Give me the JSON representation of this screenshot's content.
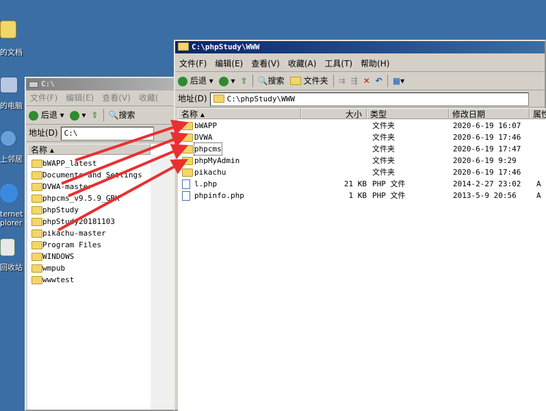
{
  "desktop": {
    "icons": [
      {
        "label": "的文档",
        "icon": "my-documents-icon"
      },
      {
        "label": "的电脑",
        "icon": "my-computer-icon"
      },
      {
        "label": "上邻居",
        "icon": "network-places-icon"
      },
      {
        "label": "ternet",
        "icon": "internet-explorer-icon",
        "label2": "plorer"
      },
      {
        "label": "回收站",
        "icon": "recycle-bin-icon"
      }
    ]
  },
  "back_window": {
    "title": "C:\\",
    "menu": [
      "文件(F)",
      "编辑(E)",
      "查看(V)",
      "收藏("
    ],
    "toolbar": {
      "back": "后退",
      "search": "搜索"
    },
    "address_label": "地址(D)",
    "address_value": "C:\\",
    "column_name": "名称",
    "items": [
      "bWAPP_latest",
      "Documents and Settings",
      "DVWA-master",
      "phpcms_v9.5.9_GBK",
      "phpStudy",
      "phpStudy20181103",
      "pikachu-master",
      "Program Files",
      "WINDOWS",
      "wmpub",
      "wwwtest"
    ]
  },
  "front_window": {
    "title": "C:\\phpStudy\\WWW",
    "menu": [
      "文件(F)",
      "编辑(E)",
      "查看(V)",
      "收藏(A)",
      "工具(T)",
      "帮助(H)"
    ],
    "toolbar": {
      "back": "后退",
      "search": "搜索",
      "folders": "文件夹"
    },
    "address_label": "地址(D)",
    "address_value": "C:\\phpStudy\\WWW",
    "columns": {
      "name": "名称",
      "size": "大小",
      "type": "类型",
      "modified": "修改日期",
      "attr": "属性"
    },
    "rows": [
      {
        "name": "bWAPP",
        "size": "",
        "type": "文件夹",
        "modified": "2020-6-19 16:07",
        "attr": "",
        "kind": "folder"
      },
      {
        "name": "DVWA",
        "size": "",
        "type": "文件夹",
        "modified": "2020-6-19 17:46",
        "attr": "",
        "kind": "folder"
      },
      {
        "name": "phpcms",
        "size": "",
        "type": "文件夹",
        "modified": "2020-6-19 17:47",
        "attr": "",
        "kind": "folder"
      },
      {
        "name": "phpMyAdmin",
        "size": "",
        "type": "文件夹",
        "modified": "2020-6-19 9:29",
        "attr": "",
        "kind": "folder"
      },
      {
        "name": "pikachu",
        "size": "",
        "type": "文件夹",
        "modified": "2020-6-19 17:46",
        "attr": "",
        "kind": "folder"
      },
      {
        "name": "l.php",
        "size": "21 KB",
        "type": "PHP 文件",
        "modified": "2014-2-27 23:02",
        "attr": "A",
        "kind": "file"
      },
      {
        "name": "phpinfo.php",
        "size": "1 KB",
        "type": "PHP 文件",
        "modified": "2013-5-9 20:56",
        "attr": "A",
        "kind": "file"
      }
    ]
  },
  "colors": {
    "desktop": "#3a6ea5",
    "arrow": "#e83030",
    "title_active": "#0a246a"
  }
}
